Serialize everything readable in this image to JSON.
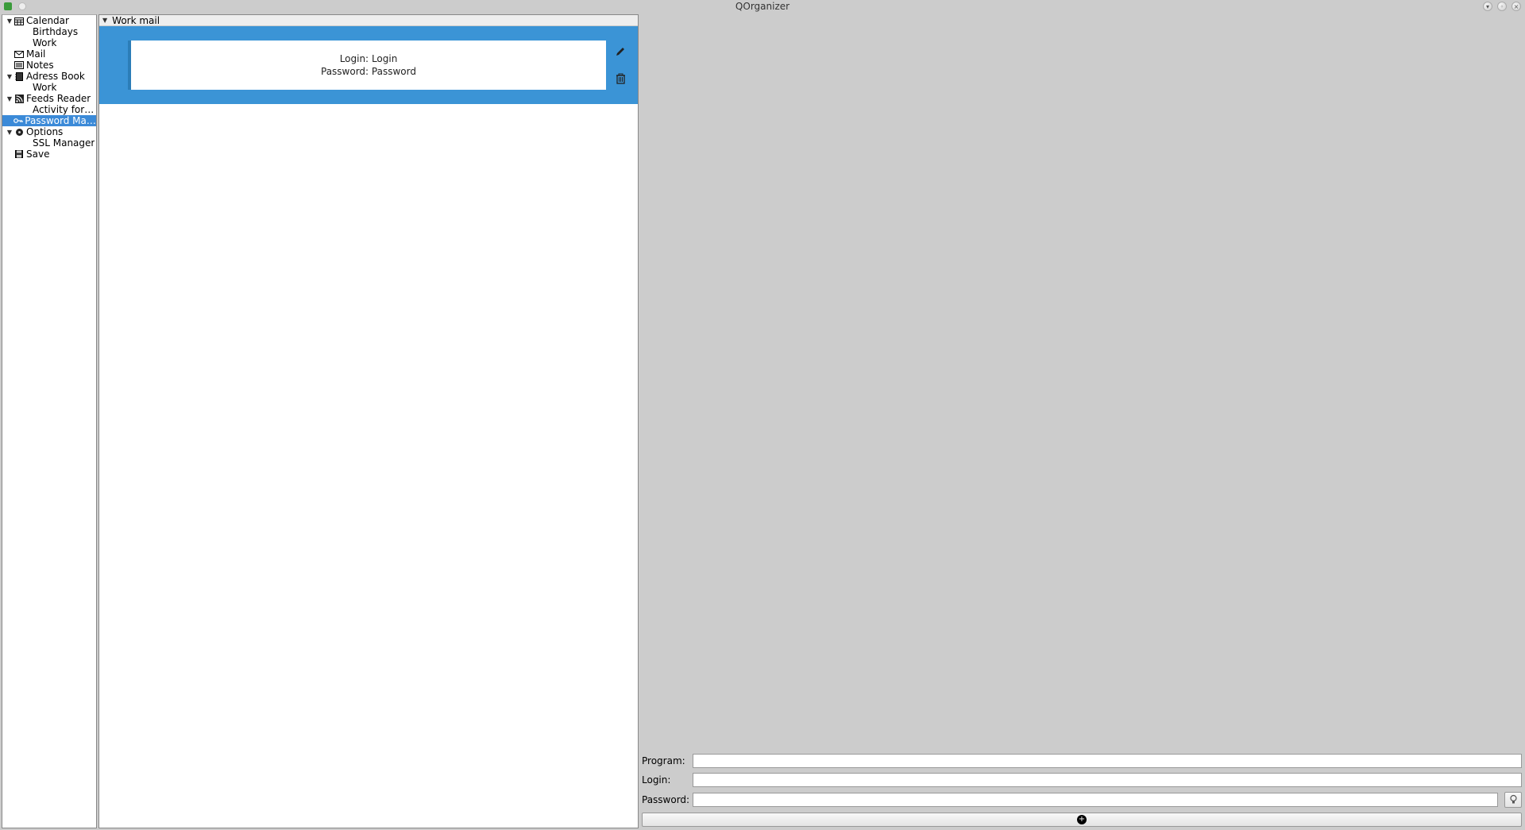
{
  "window": {
    "title": "QOrganizer"
  },
  "sidebar": {
    "items": [
      {
        "label": "Calendar",
        "icon": "calendar",
        "expand": true
      },
      {
        "label": "Birthdays",
        "child": true
      },
      {
        "label": "Work",
        "child": true
      },
      {
        "label": "Mail",
        "icon": "mail"
      },
      {
        "label": "Notes",
        "icon": "notes"
      },
      {
        "label": "Adress Book",
        "icon": "addressbook",
        "expand": true
      },
      {
        "label": "Work",
        "child": true
      },
      {
        "label": "Feeds Reader",
        "icon": "feeds",
        "expand": true
      },
      {
        "label": "Activity for QO...",
        "child": true
      },
      {
        "label": "Password Man...",
        "icon": "key",
        "selected": true
      },
      {
        "label": "Options",
        "icon": "options",
        "expand": true
      },
      {
        "label": "SSL Manager",
        "child": true
      },
      {
        "label": "Save",
        "icon": "save"
      }
    ]
  },
  "middle": {
    "header": "Work mail",
    "entry": {
      "login_label": "Login:",
      "login_value": "Login",
      "password_label": "Password:",
      "password_value": "Password"
    }
  },
  "form": {
    "program_label": "Program:",
    "login_label": "Login:",
    "password_label": "Password:",
    "program_value": "",
    "login_value": "",
    "password_value": ""
  }
}
